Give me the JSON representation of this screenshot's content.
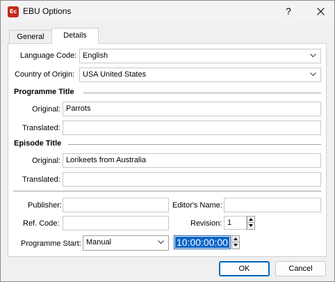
{
  "window": {
    "title": "EBU Options",
    "app_icon_text": "Ec",
    "help_label": "?"
  },
  "tabs": [
    {
      "label": "General"
    },
    {
      "label": "Details"
    }
  ],
  "details": {
    "language_code_label": "Language Code:",
    "language_code_value": "English",
    "country_label": "Country of Origin:",
    "country_value": "USA United States",
    "programme_title_heading": "Programme Title",
    "programme_original_label": "Original:",
    "programme_original_value": "Parrots",
    "programme_translated_label": "Translated:",
    "programme_translated_value": "",
    "episode_title_heading": "Episode Title",
    "episode_original_label": "Original:",
    "episode_original_value": "Lorikeets from Australia",
    "episode_translated_label": "Translated:",
    "episode_translated_value": "",
    "publisher_label": "Publisher:",
    "publisher_value": "",
    "editors_name_label": "Editor's Name:",
    "editors_name_value": "",
    "ref_code_label": "Ref. Code:",
    "ref_code_value": "",
    "revision_label": "Revision:",
    "revision_value": "1",
    "programme_start_label": "Programme Start:",
    "programme_start_mode": "Manual",
    "programme_start_time": "10:00:00:00"
  },
  "buttons": {
    "ok": "OK",
    "cancel": "Cancel"
  },
  "colors": {
    "accent": "#0067c0",
    "selection": "#0a64c8",
    "app_icon": "#c42b1c"
  }
}
